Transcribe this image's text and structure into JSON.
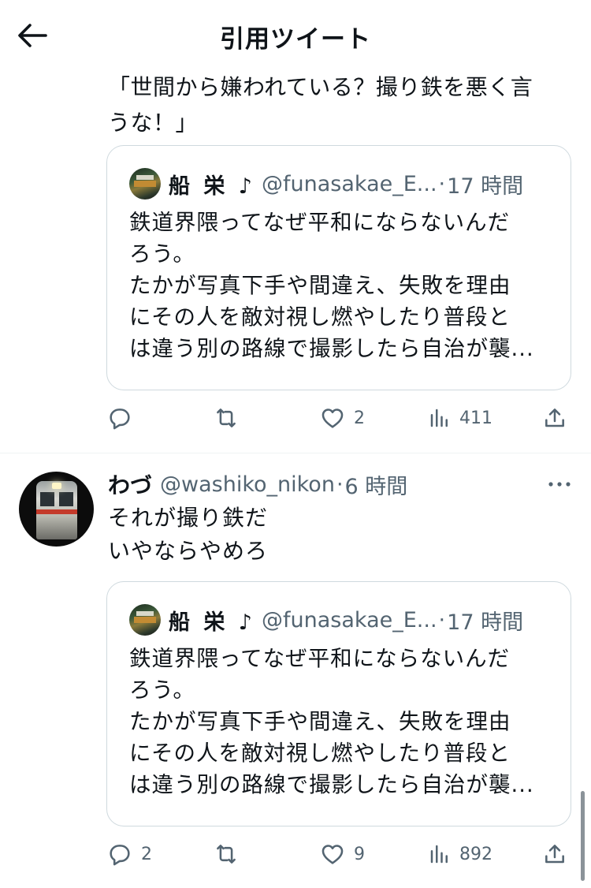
{
  "header": {
    "title": "引用ツイート"
  },
  "tweet1": {
    "text_lines": [
      "「世間から嫌われている？撮り鉄を悪く言",
      "うな！」"
    ],
    "quote": {
      "name": "船 栄 ♪",
      "handle": "@funasakae_E...",
      "separator": "·",
      "time": "17 時間",
      "lines": [
        "鉄道界隈ってなぜ平和にならないんだ",
        "ろう。",
        "たかが写真下手や間違え、失敗を理由",
        "にその人を敵対視し燃やしたり普段と",
        "は違う別の路線で撮影したら自治が襲..."
      ]
    },
    "actions": {
      "reply_count": "",
      "retweet_count": "",
      "like_count": "2",
      "views_count": "411"
    }
  },
  "tweet2": {
    "name": "わづ",
    "handle": "@washiko_nikon",
    "separator": "·",
    "time": "6 時間",
    "text_lines": [
      "それが撮り鉄だ",
      "いやならやめろ"
    ],
    "quote": {
      "name": "船 栄 ♪",
      "handle": "@funasakae_E...",
      "separator": "·",
      "time": "17 時間",
      "lines": [
        "鉄道界隈ってなぜ平和にならないんだ",
        "ろう。",
        "たかが写真下手や間違え、失敗を理由",
        "にその人を敵対視し燃やしたり普段と",
        "は違う別の路線で撮影したら自治が襲..."
      ]
    },
    "actions": {
      "reply_count": "2",
      "retweet_count": "",
      "like_count": "9",
      "views_count": "892"
    }
  },
  "icons": {
    "back": "arrow-left-icon",
    "reply": "comment-bubble-icon",
    "retweet": "retweet-icon",
    "like": "heart-outline-icon",
    "views": "bar-chart-icon",
    "share": "share-upload-icon",
    "more": "more-horizontal-icon"
  },
  "colors": {
    "text": "#0f1419",
    "secondary": "#536471",
    "border": "#cfd9de"
  }
}
